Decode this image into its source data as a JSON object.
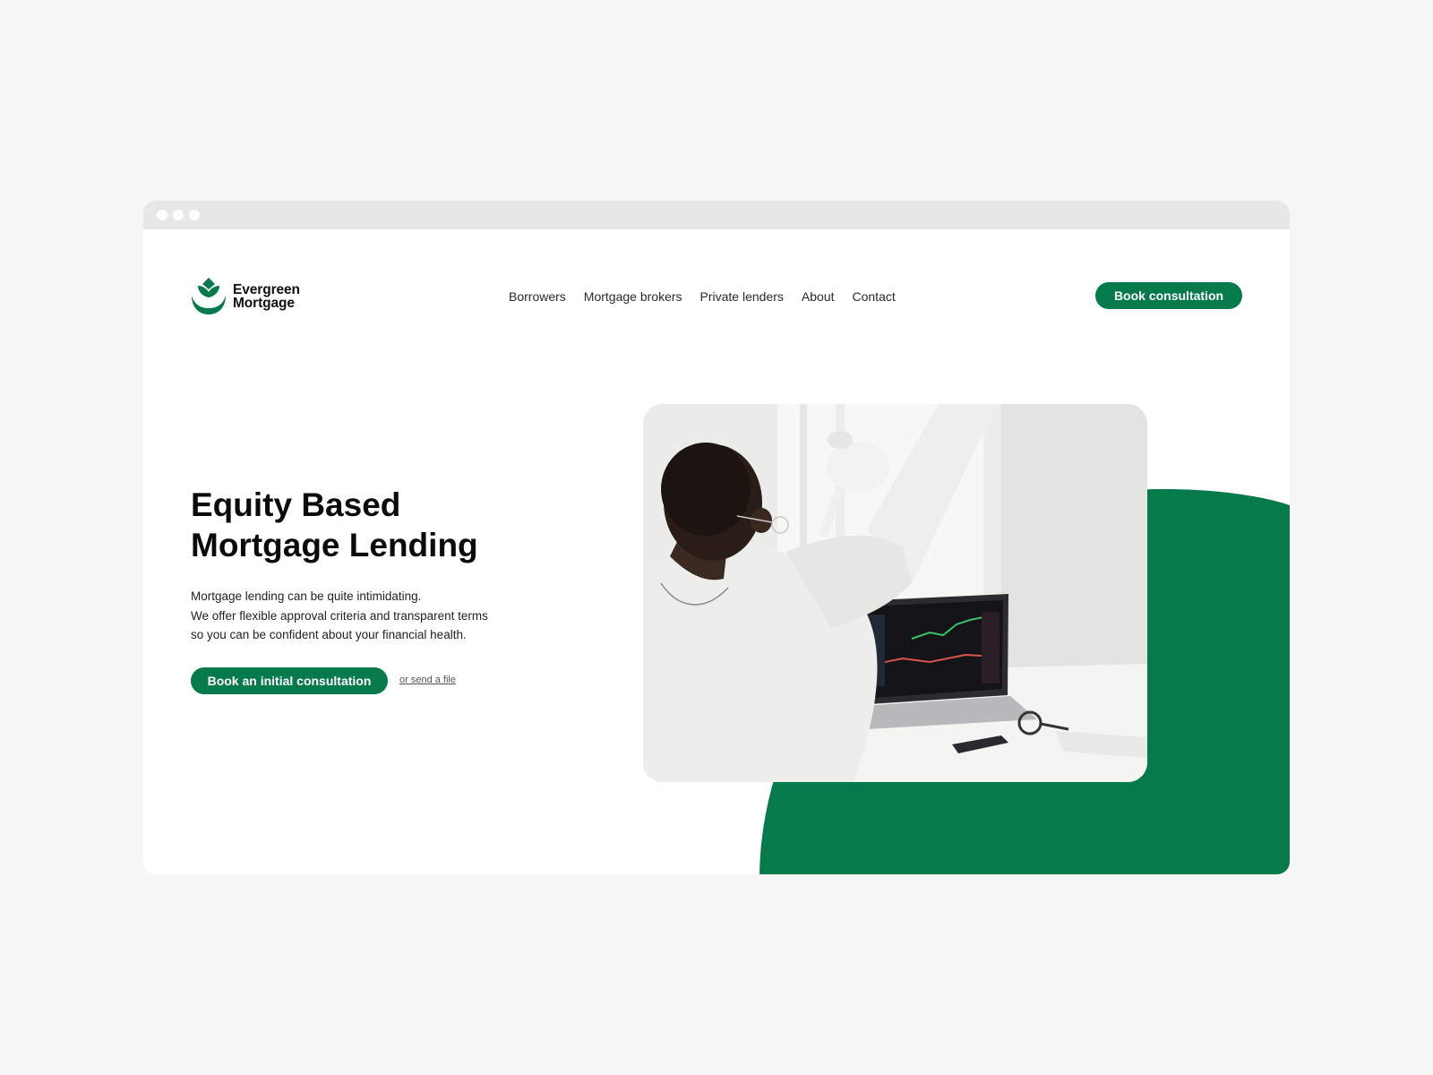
{
  "brand": {
    "name_line1": "Evergreen",
    "name_line2": "Mortgage",
    "accent_color": "#077a4b"
  },
  "nav": {
    "items": [
      {
        "label": "Borrowers"
      },
      {
        "label": "Mortgage brokers"
      },
      {
        "label": "Private lenders"
      },
      {
        "label": "About"
      },
      {
        "label": "Contact"
      }
    ],
    "cta_label": "Book consultation"
  },
  "hero": {
    "title_line1": "Equity Based",
    "title_line2": "Mortgage Lending",
    "text_line1": "Mortgage lending can be quite intimidating.",
    "text_line2": "We offer flexible approval criteria and transparent terms",
    "text_line3": "so you can be confident about your financial health.",
    "primary_cta": "Book an initial consultation",
    "secondary_link": "or send a file"
  },
  "image": {
    "icon": "hero-photo-person-celebrating-at-laptop"
  }
}
